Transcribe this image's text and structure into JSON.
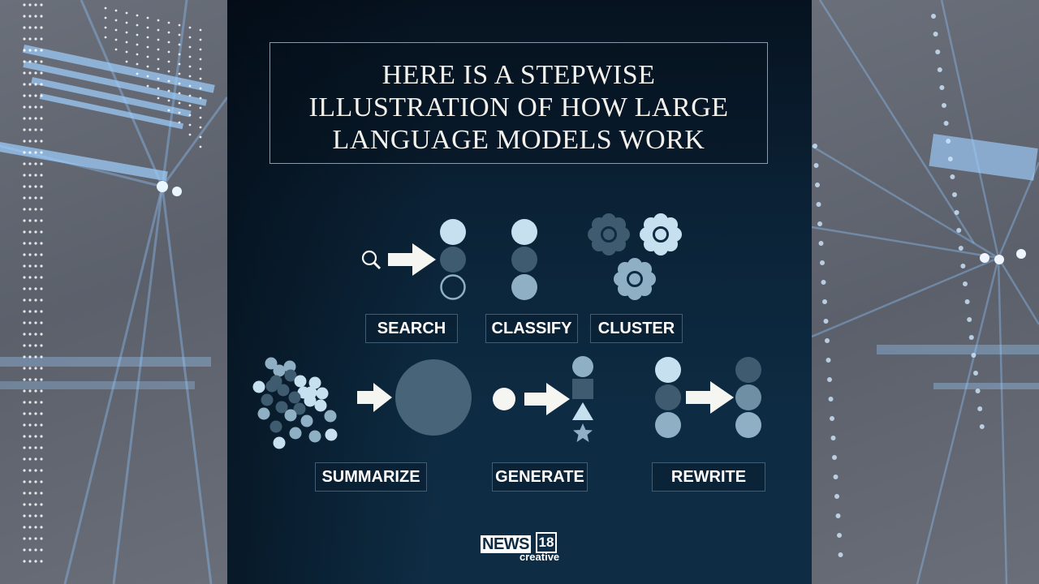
{
  "title": {
    "lines": [
      "HERE IS A STEPWISE",
      "ILLUSTRATION OF HOW LARGE",
      "LANGUAGE MODELS WORK"
    ]
  },
  "steps": [
    {
      "id": "search",
      "label": "SEARCH"
    },
    {
      "id": "classify",
      "label": "CLASSIFY"
    },
    {
      "id": "cluster",
      "label": "CLUSTER"
    },
    {
      "id": "summarize",
      "label": "SUMMARIZE"
    },
    {
      "id": "generate",
      "label": "GENERATE"
    },
    {
      "id": "rewrite",
      "label": "REWRITE"
    }
  ],
  "colors": {
    "panel": "#0d2b42",
    "light": "#c6e0f0",
    "mid": "#8fb0c4",
    "dark": "#3e5b70",
    "white": "#f5f5f2",
    "border": "#8a9aa8"
  },
  "logo": {
    "brand": "NEWS",
    "number": "18",
    "sub": "creative"
  }
}
